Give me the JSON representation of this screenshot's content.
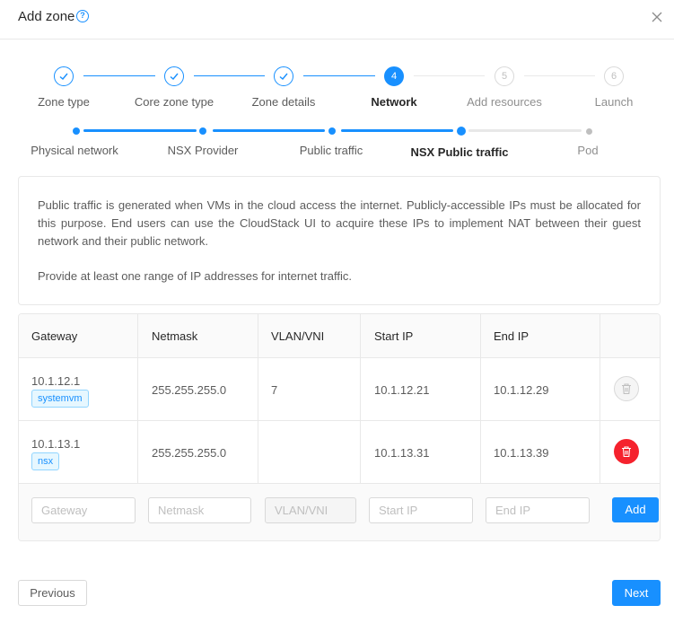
{
  "modal": {
    "title": "Add zone",
    "help_icon": "question-circle-icon",
    "close_icon": "close-icon"
  },
  "steps": [
    {
      "title": "Zone type",
      "status": "done",
      "icon": "check-icon"
    },
    {
      "title": "Core zone type",
      "status": "done",
      "icon": "check-icon"
    },
    {
      "title": "Zone details",
      "status": "done",
      "icon": "check-icon"
    },
    {
      "title": "Network",
      "status": "active",
      "number": "4"
    },
    {
      "title": "Add resources",
      "status": "wait",
      "number": "5"
    },
    {
      "title": "Launch",
      "status": "wait",
      "number": "6"
    }
  ],
  "substeps": [
    {
      "title": "Physical network",
      "status": "done"
    },
    {
      "title": "NSX Provider",
      "status": "done"
    },
    {
      "title": "Public traffic",
      "status": "done"
    },
    {
      "title": "NSX Public traffic",
      "status": "active"
    },
    {
      "title": "Pod",
      "status": "wait"
    }
  ],
  "info": {
    "paragraph1": "Public traffic is generated when VMs in the cloud access the internet. Publicly-accessible IPs must be allocated for this purpose. End users can use the CloudStack UI to acquire these IPs to implement NAT between their guest network and their public network.",
    "paragraph2": "Provide at least one range of IP addresses for internet traffic."
  },
  "table": {
    "headers": [
      "Gateway",
      "Netmask",
      "VLAN/VNI",
      "Start IP",
      "End IP",
      ""
    ],
    "rows": [
      {
        "gateway": "10.1.12.1",
        "tag": "systemvm",
        "netmask": "255.255.255.0",
        "vlan": "7",
        "start_ip": "10.1.12.21",
        "end_ip": "10.1.12.29",
        "delete_enabled": false,
        "delete_icon": "trash-icon"
      },
      {
        "gateway": "10.1.13.1",
        "tag": "nsx",
        "netmask": "255.255.255.0",
        "vlan": "",
        "start_ip": "10.1.13.31",
        "end_ip": "10.1.13.39",
        "delete_enabled": true,
        "delete_icon": "trash-icon"
      }
    ],
    "inputs": {
      "gateway_placeholder": "Gateway",
      "netmask_placeholder": "Netmask",
      "vlan_placeholder": "VLAN/VNI",
      "start_ip_placeholder": "Start IP",
      "end_ip_placeholder": "End IP",
      "add_label": "Add"
    }
  },
  "footer": {
    "previous_label": "Previous",
    "next_label": "Next"
  },
  "colors": {
    "primary": "#1890ff",
    "danger": "#f5222d",
    "border": "#e8e8e8",
    "tag_bg": "#e6f7ff"
  }
}
